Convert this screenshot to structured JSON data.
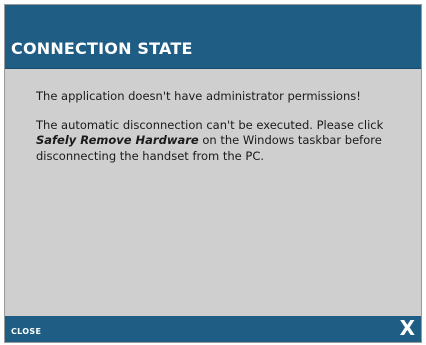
{
  "dialog": {
    "title": "CONNECTION STATE",
    "message_line1": "The application doesn't have administrator permissions!",
    "message2_part1": "The automatic disconnection can't be executed. Please click ",
    "message2_emphasis": "Safely Remove Hardware",
    "message2_part2": " on the Windows taskbar before disconnecting the handset from the PC."
  },
  "footer": {
    "close_label": "CLOSE",
    "close_x": "X"
  },
  "colors": {
    "header_bg": "#1f5d85",
    "body_bg": "#cfcfcf",
    "text": "#1a1a1a"
  }
}
